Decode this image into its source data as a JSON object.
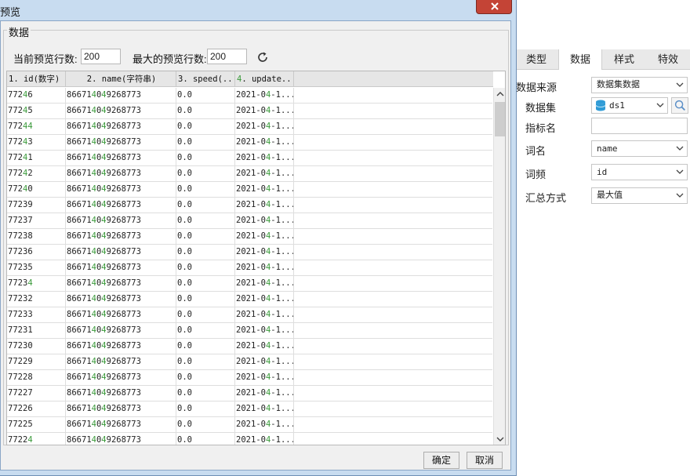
{
  "dialog": {
    "title": "预览",
    "group_title": "数据",
    "current_rows_label": "当前预览行数:",
    "current_rows_value": "200",
    "max_rows_label": "最大的预览行数:",
    "max_rows_value": "200",
    "ok_label": "确定",
    "cancel_label": "取消",
    "columns": [
      "1. id(数字)",
      "2. name(字符串)",
      "3. speed(...",
      "4. update..."
    ],
    "rows": [
      {
        "id": "77246",
        "name": "866714049268773",
        "speed": "0.0",
        "update": "2021-04-1..."
      },
      {
        "id": "77245",
        "name": "866714049268773",
        "speed": "0.0",
        "update": "2021-04-1..."
      },
      {
        "id": "77244",
        "name": "866714049268773",
        "speed": "0.0",
        "update": "2021-04-1..."
      },
      {
        "id": "77243",
        "name": "866714049268773",
        "speed": "0.0",
        "update": "2021-04-1..."
      },
      {
        "id": "77241",
        "name": "866714049268773",
        "speed": "0.0",
        "update": "2021-04-1..."
      },
      {
        "id": "77242",
        "name": "866714049268773",
        "speed": "0.0",
        "update": "2021-04-1..."
      },
      {
        "id": "77240",
        "name": "866714049268773",
        "speed": "0.0",
        "update": "2021-04-1..."
      },
      {
        "id": "77239",
        "name": "866714049268773",
        "speed": "0.0",
        "update": "2021-04-1..."
      },
      {
        "id": "77237",
        "name": "866714049268773",
        "speed": "0.0",
        "update": "2021-04-1..."
      },
      {
        "id": "77238",
        "name": "866714049268773",
        "speed": "0.0",
        "update": "2021-04-1..."
      },
      {
        "id": "77236",
        "name": "866714049268773",
        "speed": "0.0",
        "update": "2021-04-1..."
      },
      {
        "id": "77235",
        "name": "866714049268773",
        "speed": "0.0",
        "update": "2021-04-1..."
      },
      {
        "id": "77234",
        "name": "866714049268773",
        "speed": "0.0",
        "update": "2021-04-1..."
      },
      {
        "id": "77232",
        "name": "866714049268773",
        "speed": "0.0",
        "update": "2021-04-1..."
      },
      {
        "id": "77233",
        "name": "866714049268773",
        "speed": "0.0",
        "update": "2021-04-1..."
      },
      {
        "id": "77231",
        "name": "866714049268773",
        "speed": "0.0",
        "update": "2021-04-1..."
      },
      {
        "id": "77230",
        "name": "866714049268773",
        "speed": "0.0",
        "update": "2021-04-1..."
      },
      {
        "id": "77229",
        "name": "866714049268773",
        "speed": "0.0",
        "update": "2021-04-1..."
      },
      {
        "id": "77228",
        "name": "866714049268773",
        "speed": "0.0",
        "update": "2021-04-1..."
      },
      {
        "id": "77227",
        "name": "866714049268773",
        "speed": "0.0",
        "update": "2021-04-1..."
      },
      {
        "id": "77226",
        "name": "866714049268773",
        "speed": "0.0",
        "update": "2021-04-1..."
      },
      {
        "id": "77225",
        "name": "866714049268773",
        "speed": "0.0",
        "update": "2021-04-1..."
      },
      {
        "id": "77224",
        "name": "866714049268773",
        "speed": "0.0",
        "update": "2021-04-1..."
      }
    ]
  },
  "panel": {
    "tabs": [
      "类型",
      "数据",
      "样式",
      "特效"
    ],
    "active_tab": "数据",
    "data_source_label": "数据来源",
    "data_source_value": "数据集数据",
    "dataset_label": "数据集",
    "dataset_value": "ds1",
    "metric_label": "指标名",
    "metric_value": "",
    "word_label": "词名",
    "word_value": "name",
    "freq_label": "词频",
    "freq_value": "id",
    "agg_label": "汇总方式",
    "agg_value": "最大值"
  },
  "colors": {
    "title_bar": "#c8dcf0",
    "close_button": "#c44436",
    "highlight_digit": "#3b9a3b",
    "dataset_icon": "#2f9bd6"
  },
  "icons": [
    "close-icon",
    "refresh-icon",
    "database-icon",
    "search-icon",
    "chevron-down-icon",
    "scroll-up-icon",
    "scroll-down-icon"
  ]
}
